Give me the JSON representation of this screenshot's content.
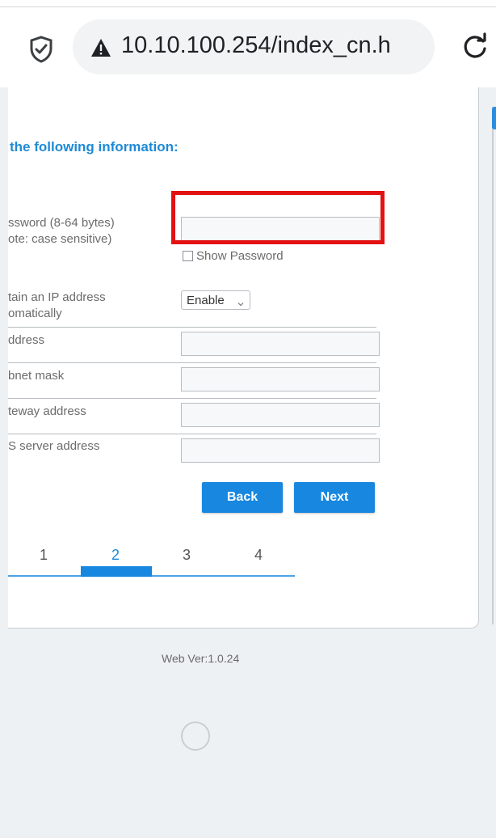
{
  "browser": {
    "url": "10.10.100.254/index_cn.h",
    "icons": {
      "site_security": "shield-icon",
      "connection_warning": "warning-triangle-icon",
      "reload": "reload-icon"
    }
  },
  "wizard": {
    "heading": "the following information:",
    "password": {
      "label_line1": "ssword (8-64 bytes)",
      "label_line2": "ote: case sensitive)",
      "value": "",
      "show_password_label": "Show Password",
      "show_password_checked": false
    },
    "dhcp": {
      "label_line1": "tain an IP address",
      "label_line2": "omatically",
      "selected": "Enable"
    },
    "ip_address": {
      "label": "ddress",
      "value": ""
    },
    "subnet_mask": {
      "label": "bnet mask",
      "value": ""
    },
    "gateway_address": {
      "label": "teway address",
      "value": ""
    },
    "dns_server_address": {
      "label": "S server address",
      "value": ""
    },
    "buttons": {
      "back": "Back",
      "next": "Next"
    },
    "steps": [
      "1",
      "2",
      "3",
      "4"
    ],
    "current_step": 2
  },
  "footer": {
    "version": "Web Ver:1.0.24"
  },
  "colors": {
    "accent": "#1787e0",
    "heading": "#1e8ad6",
    "highlight": "#e31212"
  }
}
